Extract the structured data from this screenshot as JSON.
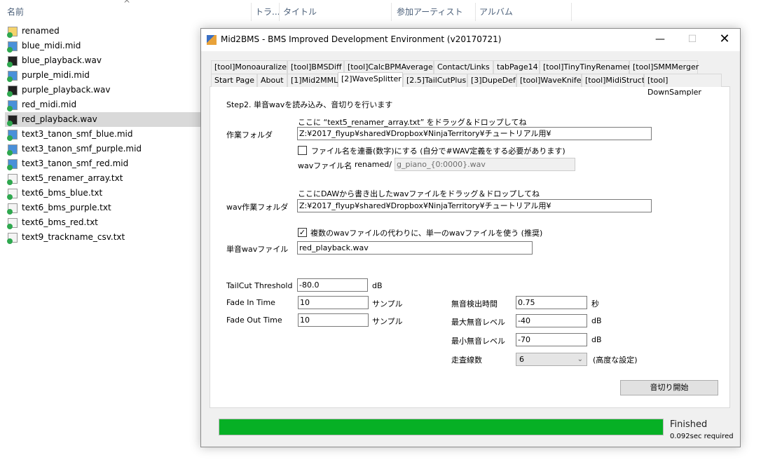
{
  "explorer": {
    "columns": [
      "名前",
      "トラ...",
      "タイトル",
      "参加アーティスト",
      "アルバム"
    ],
    "files": [
      {
        "name": "renamed",
        "type": "folder"
      },
      {
        "name": "blue_midi.mid",
        "type": "midi"
      },
      {
        "name": "blue_playback.wav",
        "type": "wav"
      },
      {
        "name": "purple_midi.mid",
        "type": "midi"
      },
      {
        "name": "purple_playback.wav",
        "type": "wav"
      },
      {
        "name": "red_midi.mid",
        "type": "midi"
      },
      {
        "name": "red_playback.wav",
        "type": "wav",
        "selected": true
      },
      {
        "name": "text3_tanon_smf_blue.mid",
        "type": "midi"
      },
      {
        "name": "text3_tanon_smf_purple.mid",
        "type": "midi"
      },
      {
        "name": "text3_tanon_smf_red.mid",
        "type": "midi"
      },
      {
        "name": "text5_renamer_array.txt",
        "type": "txt"
      },
      {
        "name": "text6_bms_blue.txt",
        "type": "txt"
      },
      {
        "name": "text6_bms_purple.txt",
        "type": "txt"
      },
      {
        "name": "text6_bms_red.txt",
        "type": "txt"
      },
      {
        "name": "text9_trackname_csv.txt",
        "type": "txt"
      }
    ]
  },
  "window": {
    "title": "Mid2BMS - BMS Improved Development Environment (v20170721)",
    "tabs_row1": [
      "[tool]Monoauralizer",
      "[tool]BMSDiff",
      "[tool]CalcBPMAverage",
      "Contact/Links",
      "tabPage14",
      "[tool]TinyTinyRenamer",
      "[tool]SMMMerger"
    ],
    "tabs_row2": [
      "Start Page",
      "About",
      "[1]Mid2MML",
      "[2]WaveSplitter",
      "[2.5]TailCutPlus",
      "[3]DupeDef",
      "[tool]WaveKnife",
      "[tool]MidiStruct",
      "[tool] DownSampler"
    ],
    "active_tab": "[2]WaveSplitter"
  },
  "form": {
    "step": "Step2. 単音wavを読み込み、音切りを行います",
    "hint1": "ここに “text5_renamer_array.txt” をドラッグ＆ドロップしてね",
    "work_folder_label": "作業フォルダ",
    "work_folder": "Z:¥2017_flyup¥shared¥Dropbox¥NinjaTerritory¥チュートリアル用¥",
    "serial_checkbox": {
      "label": "ファイル名を連番(数字)にする (自分で#WAV定義をする必要があります)",
      "checked": false
    },
    "wav_name_label": "wavファイル名",
    "wav_name_prefix": "renamed/",
    "wav_name": "g_piano_{0:0000}.wav",
    "hint2": "ここにDAWから書き出したwavファイルをドラッグ＆ドロップしてね",
    "wav_folder_label": "wav作業フォルダ",
    "wav_folder": "Z:¥2017_flyup¥shared¥Dropbox¥NinjaTerritory¥チュートリアル用¥",
    "single_checkbox": {
      "label": "複数のwavファイルの代わりに、単一のwavファイルを使う (推奨)",
      "checked": true
    },
    "single_wav_label": "単音wavファイル",
    "single_wav": "red_playback.wav",
    "tailcut_label": "TailCut Threshold",
    "tailcut": "-80.0",
    "tailcut_unit": "dB",
    "fadein_label": "Fade In Time",
    "fadein": "10",
    "fadein_unit": "サンプル",
    "fadeout_label": "Fade Out Time",
    "fadeout": "10",
    "fadeout_unit": "サンプル",
    "silence_time_label": "無音検出時間",
    "silence_time": "0.75",
    "silence_time_unit": "秒",
    "max_silence_label": "最大無音レベル",
    "max_silence": "-40",
    "max_silence_unit": "dB",
    "min_silence_label": "最小無音レベル",
    "min_silence": "-70",
    "min_silence_unit": "dB",
    "scanlines_label": "走査線数",
    "scanlines": "6",
    "scanlines_note": "(高度な設定)",
    "start_button": "音切り開始"
  },
  "status": {
    "progress_percent": 100,
    "text": "Finished",
    "time": "0.092sec required",
    "bar_color": "#06b025"
  }
}
